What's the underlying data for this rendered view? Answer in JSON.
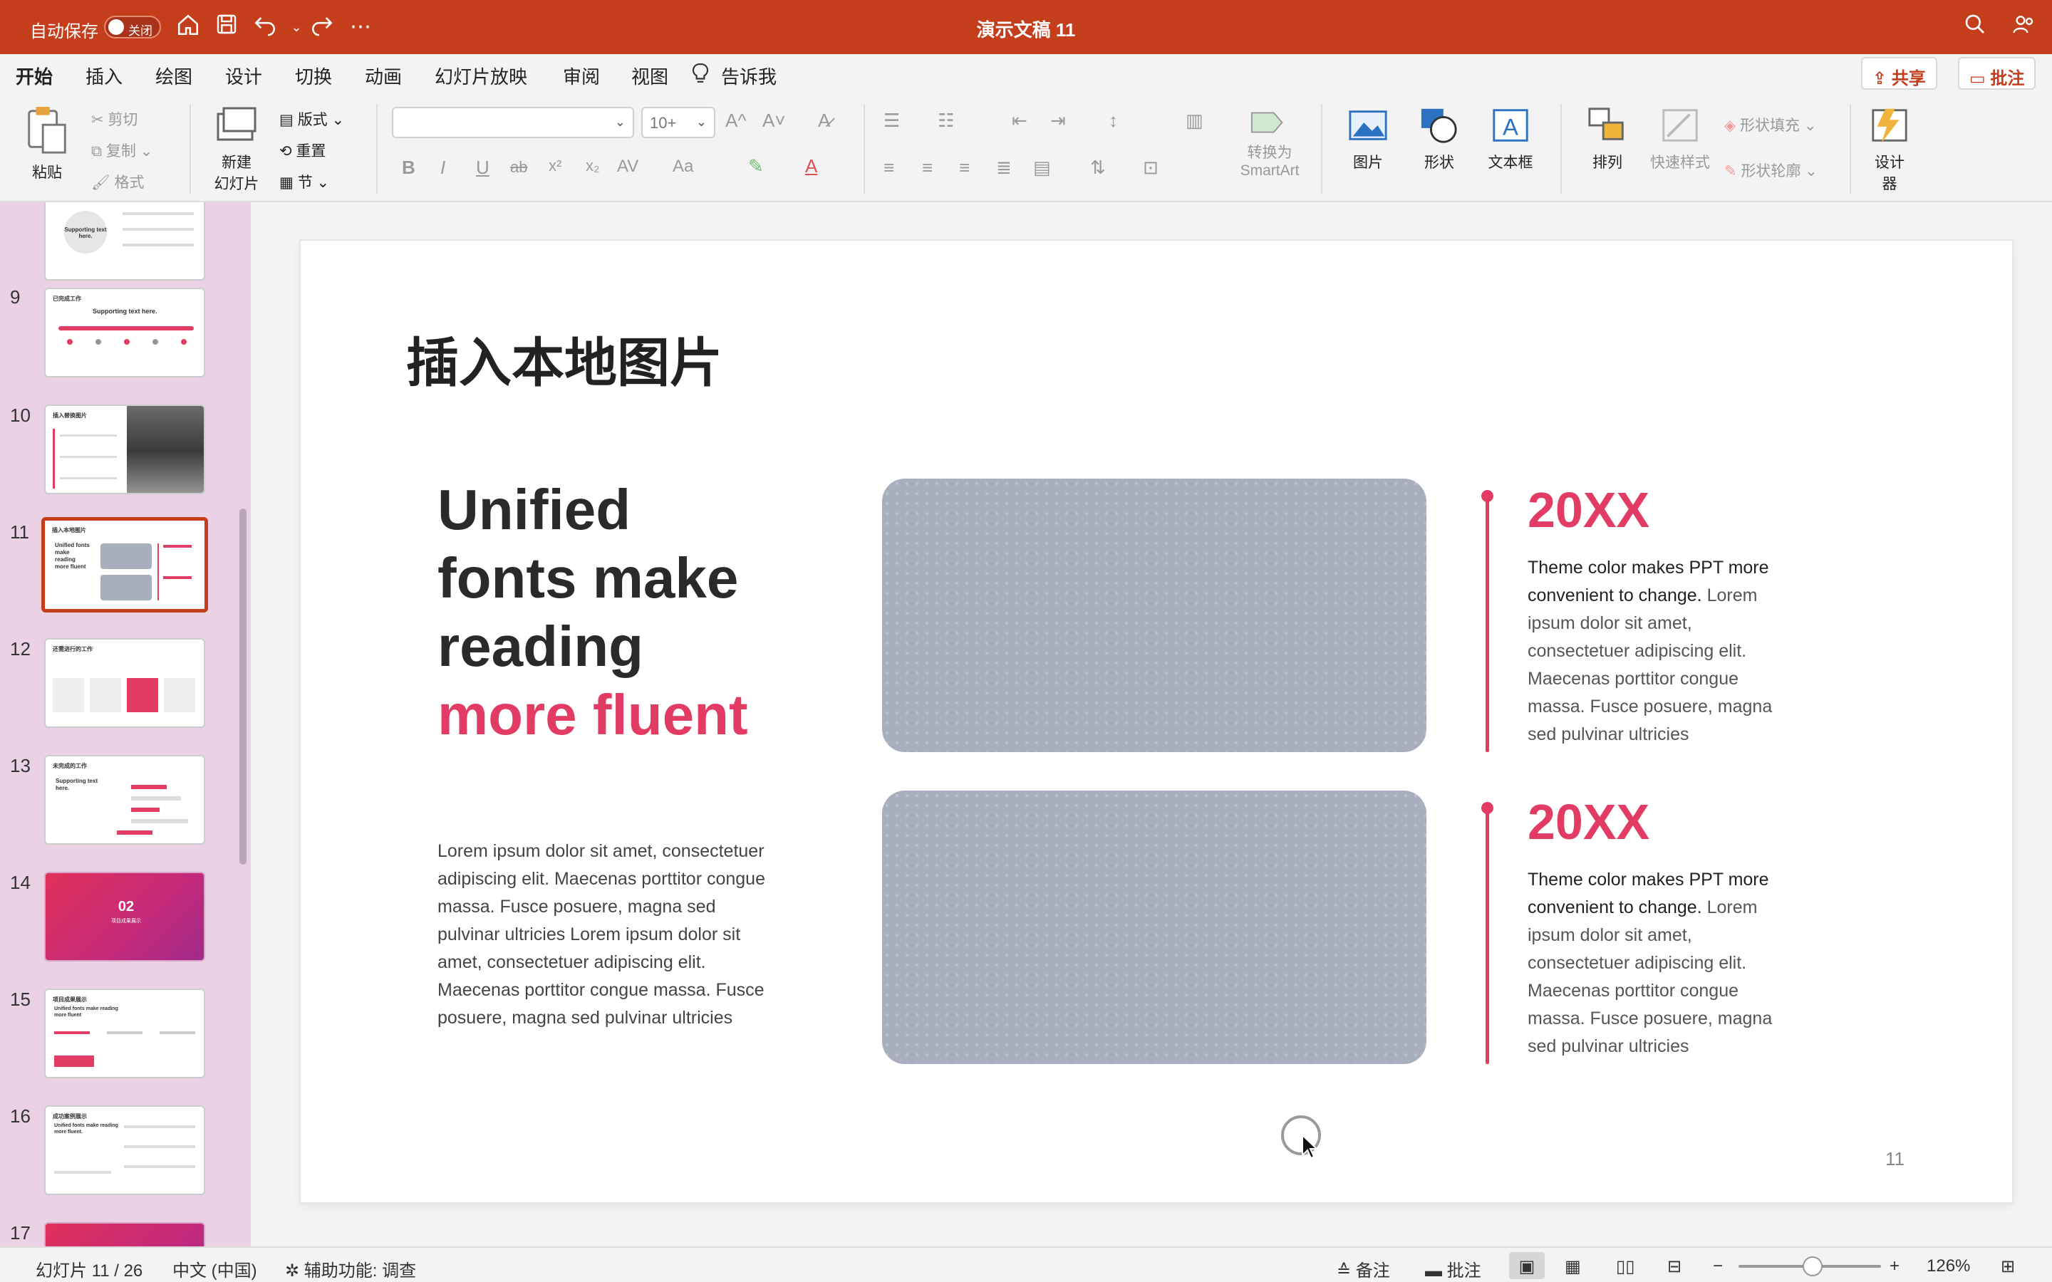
{
  "titlebar": {
    "autosave_label": "自动保存",
    "autosave_state": "关闭",
    "document_title": "演示文稿 11",
    "icons": [
      "home-icon",
      "save-icon",
      "undo-icon",
      "redo-icon",
      "more-icon",
      "search-icon",
      "share-person-icon"
    ]
  },
  "tabs": [
    "开始",
    "插入",
    "绘图",
    "设计",
    "切换",
    "动画",
    "幻灯片放映",
    "审阅",
    "视图"
  ],
  "tell_me": "告诉我",
  "share_label": "共享",
  "comments_label": "批注",
  "ribbon": {
    "paste": "粘贴",
    "cut": "剪切",
    "copy": "复制",
    "format": "格式",
    "new_slide": [
      "新建",
      "幻灯片"
    ],
    "layout": "版式",
    "reset": "重置",
    "section": "节",
    "font_name": "",
    "font_size": "10+",
    "bold": "B",
    "italic": "I",
    "underline": "U",
    "strike": "ab",
    "superscript": "x²",
    "subscript": "x₂",
    "spacing": "AV",
    "case": "Aa",
    "grow": "A^",
    "shrink": "A˅",
    "convert_smartart": [
      "转换为",
      "SmartArt"
    ],
    "picture": "图片",
    "shape": "形状",
    "textbox": "文本框",
    "arrange": "排列",
    "quick_styles": "快速样式",
    "shape_fill": "形状填充",
    "shape_outline": "形状轮廓",
    "designer": [
      "设计",
      "器"
    ]
  },
  "thumbnails": [
    {
      "num": "",
      "title": "",
      "subtitle": "Supporting text here."
    },
    {
      "num": "9",
      "title": "已完成工作",
      "subtitle": "Supporting text here."
    },
    {
      "num": "10",
      "title": "插入替换图片",
      "subtitle": ""
    },
    {
      "num": "11",
      "title": "插入本地图片",
      "subtitle": "Unified fonts make reading more fluent"
    },
    {
      "num": "12",
      "title": "还需进行的工作",
      "subtitle": ""
    },
    {
      "num": "13",
      "title": "未完成的工作",
      "subtitle": "Supporting text here."
    },
    {
      "num": "14",
      "title": "02",
      "subtitle": "项目成果展示"
    },
    {
      "num": "15",
      "title": "项目成果展示",
      "subtitle": "Unified fonts make reading more fluent"
    },
    {
      "num": "16",
      "title": "成功案例展示",
      "subtitle": "Unified fonts make reading more fluent."
    },
    {
      "num": "17",
      "title": "",
      "subtitle": ""
    }
  ],
  "slide": {
    "title": "插入本地图片",
    "headline_lines": [
      "Unified",
      "fonts make",
      "reading"
    ],
    "headline_accent": "more fluent",
    "body": "Lorem ipsum dolor sit amet, consectetuer adipiscing elit. Maecenas porttitor congue massa. Fusce posuere, magna sed pulvinar ultricies Lorem ipsum dolor sit amet, consectetuer adipiscing elit. Maecenas porttitor congue massa. Fusce posuere, magna sed pulvinar ultricies",
    "items": [
      {
        "year": "20XX",
        "lead": "Theme color makes PPT more convenient to change.",
        "text": " Lorem ipsum dolor sit amet, consectetuer adipiscing elit. Maecenas porttitor congue massa. Fusce posuere, magna sed pulvinar ultricies"
      },
      {
        "year": "20XX",
        "lead": "Theme color makes PPT more convenient to change.",
        "text": " Lorem ipsum dolor sit amet, consectetuer adipiscing elit. Maecenas porttitor congue massa. Fusce posuere, magna sed pulvinar ultricies"
      }
    ],
    "page_number": "11",
    "accent_color": "#e23c64"
  },
  "statusbar": {
    "slide_info": "幻灯片 11 / 26",
    "language": "中文 (中国)",
    "accessibility": "辅助功能: 调查",
    "notes": "备注",
    "comments": "批注",
    "zoom": "126%"
  }
}
